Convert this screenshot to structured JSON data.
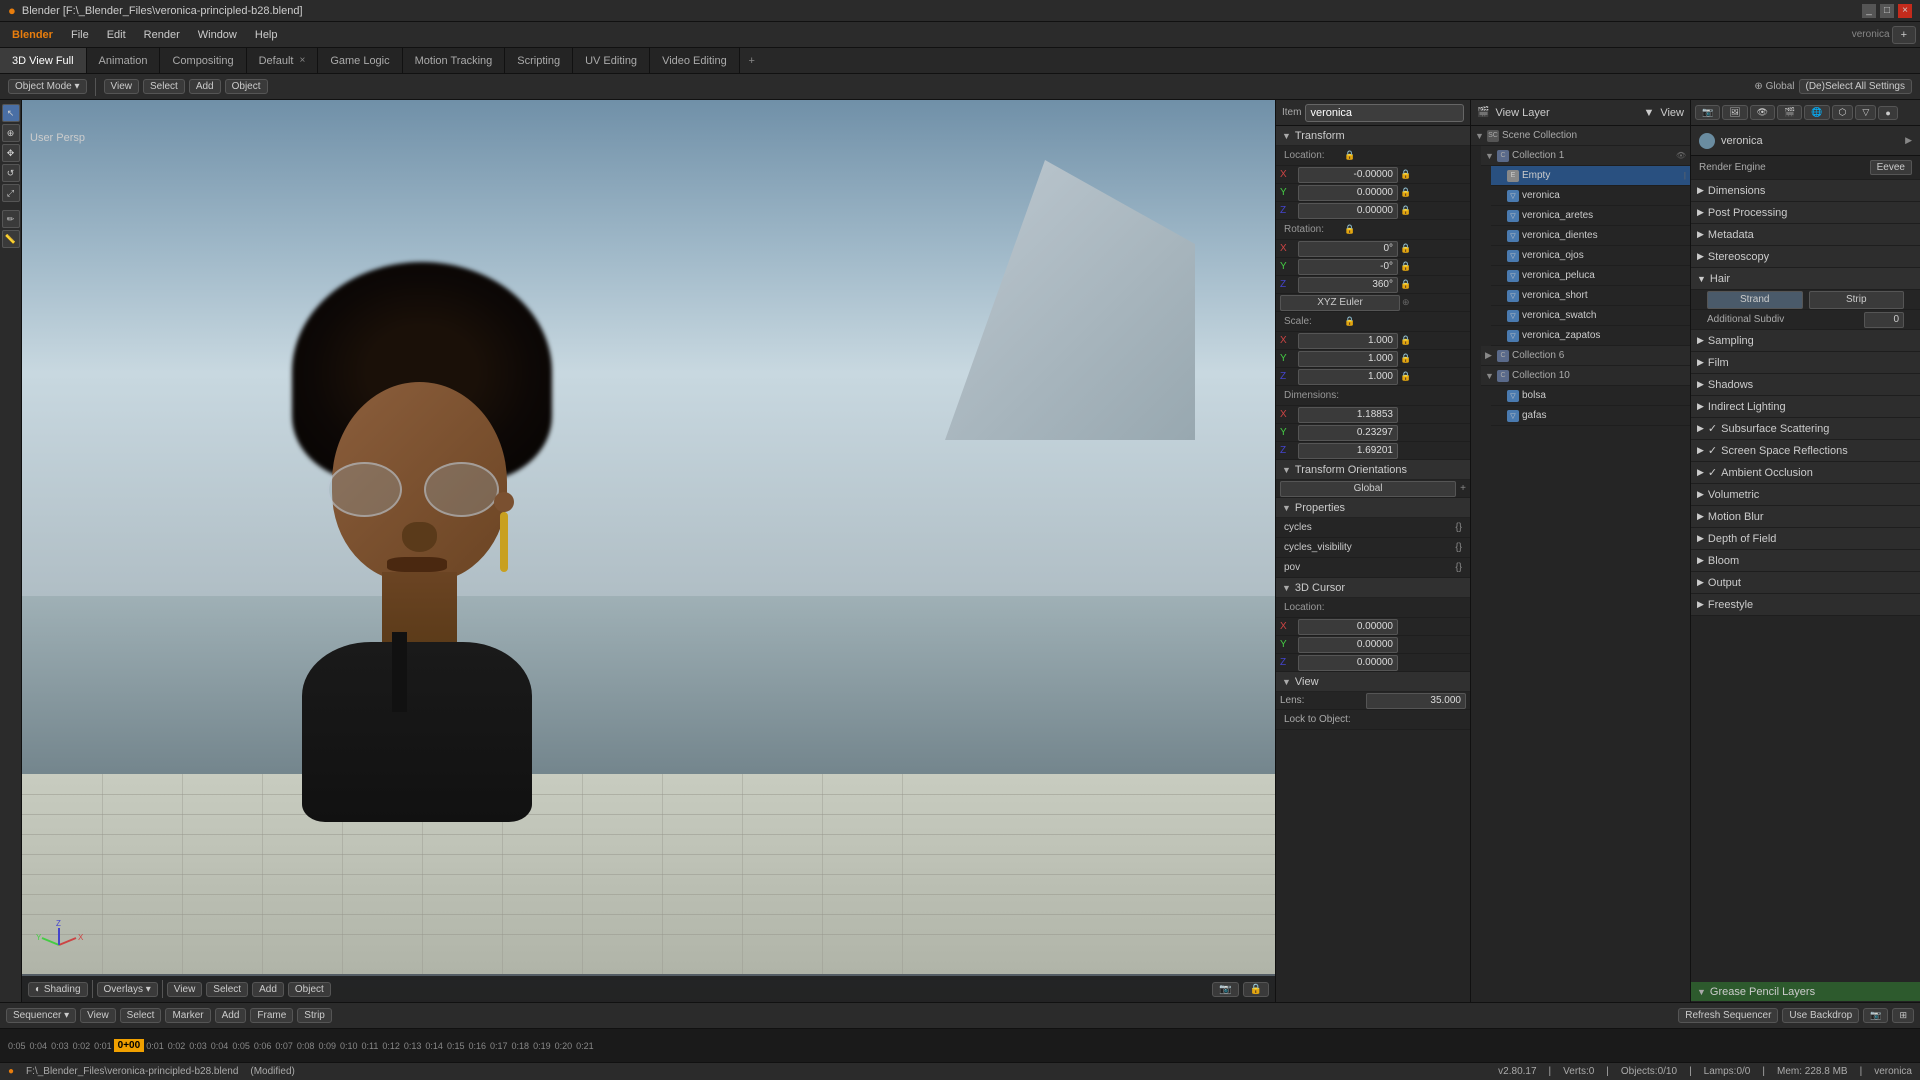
{
  "window": {
    "title": "Blender  [F:\\_Blender_Files\\veronica-principled-b28.blend]",
    "controls": [
      "_",
      "□",
      "×"
    ]
  },
  "menu": {
    "items": [
      "Blender",
      "File",
      "Edit",
      "Render",
      "Window",
      "Help"
    ]
  },
  "tabs": [
    {
      "label": "3D View Full",
      "active": true
    },
    {
      "label": "Animation"
    },
    {
      "label": "Compositing"
    },
    {
      "label": "Default",
      "closable": true
    },
    {
      "label": "Game Logic"
    },
    {
      "label": "Motion Tracking"
    },
    {
      "label": "Scripting"
    },
    {
      "label": "UV Editing"
    },
    {
      "label": "Video Editing"
    }
  ],
  "header_toolbar": {
    "mode_label": "Object Mode",
    "view_label": "View",
    "select_label": "Select",
    "add_label": "Add",
    "object_label": "Object"
  },
  "viewport": {
    "label": "User Persp",
    "footer_buttons": [
      "Overlays ▾",
      "View",
      "Select",
      "Add",
      "Object"
    ]
  },
  "item_panel": {
    "name": "veronica",
    "transform_section": "Transform",
    "location": {
      "label": "Location:",
      "x": "-0.00000",
      "y": "0.00000",
      "z": "0.00000"
    },
    "rotation": {
      "label": "Rotation:",
      "x": "0°",
      "y": "-0°",
      "z": "360°",
      "mode": "XYZ Euler"
    },
    "scale": {
      "label": "Scale:",
      "x": "1.000",
      "y": "1.000",
      "z": "1.000"
    },
    "dimensions": {
      "label": "Dimensions:",
      "x": "1.18853",
      "y": "0.23297",
      "z": "1.69201"
    },
    "transform_orientations": "Transform Orientations",
    "global": "Global",
    "properties_section": "Properties",
    "cycles": "cycles",
    "cycles_val": "{}",
    "cycles_visibility": "cycles_visibility",
    "cycles_visibility_val": "{}",
    "pov": "pov",
    "pov_val": "{}",
    "cursor_section": "3D Cursor",
    "cursor_location": {
      "label": "Location:",
      "x": "0.00000",
      "y": "0.00000",
      "z": "0.00000"
    },
    "view_section": "View",
    "lens": {
      "label": "Lens:",
      "val": "35.000"
    },
    "lock_to_object": "Lock to Object:"
  },
  "scene_tree": {
    "header": "View Layer",
    "scene_collection": "Scene Collection",
    "collection1": "Collection 1",
    "items": [
      {
        "name": "Empty",
        "type": "empty",
        "selected": true,
        "indent": 2
      },
      {
        "name": "veronica",
        "type": "mesh",
        "indent": 2
      },
      {
        "name": "veronica_aretes",
        "type": "mesh",
        "indent": 2
      },
      {
        "name": "veronica_dientes",
        "type": "mesh",
        "indent": 2
      },
      {
        "name": "veronica_ojos",
        "type": "mesh",
        "indent": 2
      },
      {
        "name": "veronica_peluca",
        "type": "mesh",
        "indent": 2
      },
      {
        "name": "veronica_short",
        "type": "mesh",
        "indent": 2
      },
      {
        "name": "veronica_swatch",
        "type": "mesh",
        "indent": 2
      },
      {
        "name": "veronica_zapatos",
        "type": "mesh",
        "indent": 2
      }
    ],
    "collection6": "Collection 6",
    "collection10": "Collection 10",
    "sub_items": [
      {
        "name": "bolsa",
        "type": "mesh",
        "indent": 2
      },
      {
        "name": "gafas",
        "type": "mesh",
        "indent": 2
      }
    ]
  },
  "render_props": {
    "title": "veronica",
    "render_engine_label": "Render Engine",
    "render_engine": "Eevee",
    "sections": [
      {
        "label": "Dimensions",
        "expanded": false
      },
      {
        "label": "Post Processing",
        "expanded": false
      },
      {
        "label": "Metadata",
        "expanded": false
      },
      {
        "label": "Stereoscopy",
        "expanded": false
      },
      {
        "label": "Hair",
        "expanded": true
      },
      {
        "label": "Sampling",
        "expanded": false
      },
      {
        "label": "Film",
        "expanded": false
      },
      {
        "label": "Shadows",
        "expanded": false
      },
      {
        "label": "Indirect Lighting",
        "expanded": false
      },
      {
        "label": "Subsurface Scattering",
        "expanded": false,
        "enabled": true
      },
      {
        "label": "Screen Space Reflections",
        "expanded": false,
        "enabled": true
      },
      {
        "label": "Ambient Occlusion",
        "expanded": false,
        "enabled": true
      },
      {
        "label": "Volumetric",
        "expanded": false
      },
      {
        "label": "Motion Blur",
        "expanded": false
      },
      {
        "label": "Depth of Field",
        "expanded": false
      },
      {
        "label": "Bloom",
        "expanded": false
      },
      {
        "label": "Output",
        "expanded": false
      },
      {
        "label": "Freestyle",
        "expanded": false
      }
    ],
    "hair": {
      "strand_label": "Strand",
      "strip_label": "Strip",
      "additional_subdiv_label": "Additional Subdiv",
      "additional_subdiv_val": "0"
    }
  },
  "sequencer": {
    "header_buttons": [
      "Sequencer ▾",
      "View",
      "Select",
      "Marker",
      "Add",
      "Frame",
      "Strip"
    ],
    "refresh_label": "Refresh Sequencer",
    "use_backdrop": "Use Backdrop"
  },
  "timeline": {
    "frames": [
      "0:05",
      "0:04",
      "0:03",
      "0:02",
      "0:01",
      "0+00",
      "0:01",
      "0:02",
      "0:03",
      "0:04",
      "0:05",
      "0:06",
      "0:07",
      "0:08",
      "0:09",
      "0:10",
      "0:11",
      "0:12",
      "0:13",
      "0:14",
      "0:15",
      "0:16",
      "0:17",
      "0:18",
      "0:19",
      "0:20",
      "0:21"
    ],
    "current": "0+00"
  },
  "status_bar": {
    "version": "v2.80.17",
    "verts": "Verts:0",
    "objects": "Objects:0/10",
    "lamps": "Lamps:0/0",
    "mem": "Mem: 228.8 MB",
    "file": "F:\\_Blender_Files\\veronica-principled-b28.blend",
    "modified": "(Modified)",
    "user": "veronica"
  },
  "grease_pencil": {
    "label": "Grease Pencil Layers"
  }
}
